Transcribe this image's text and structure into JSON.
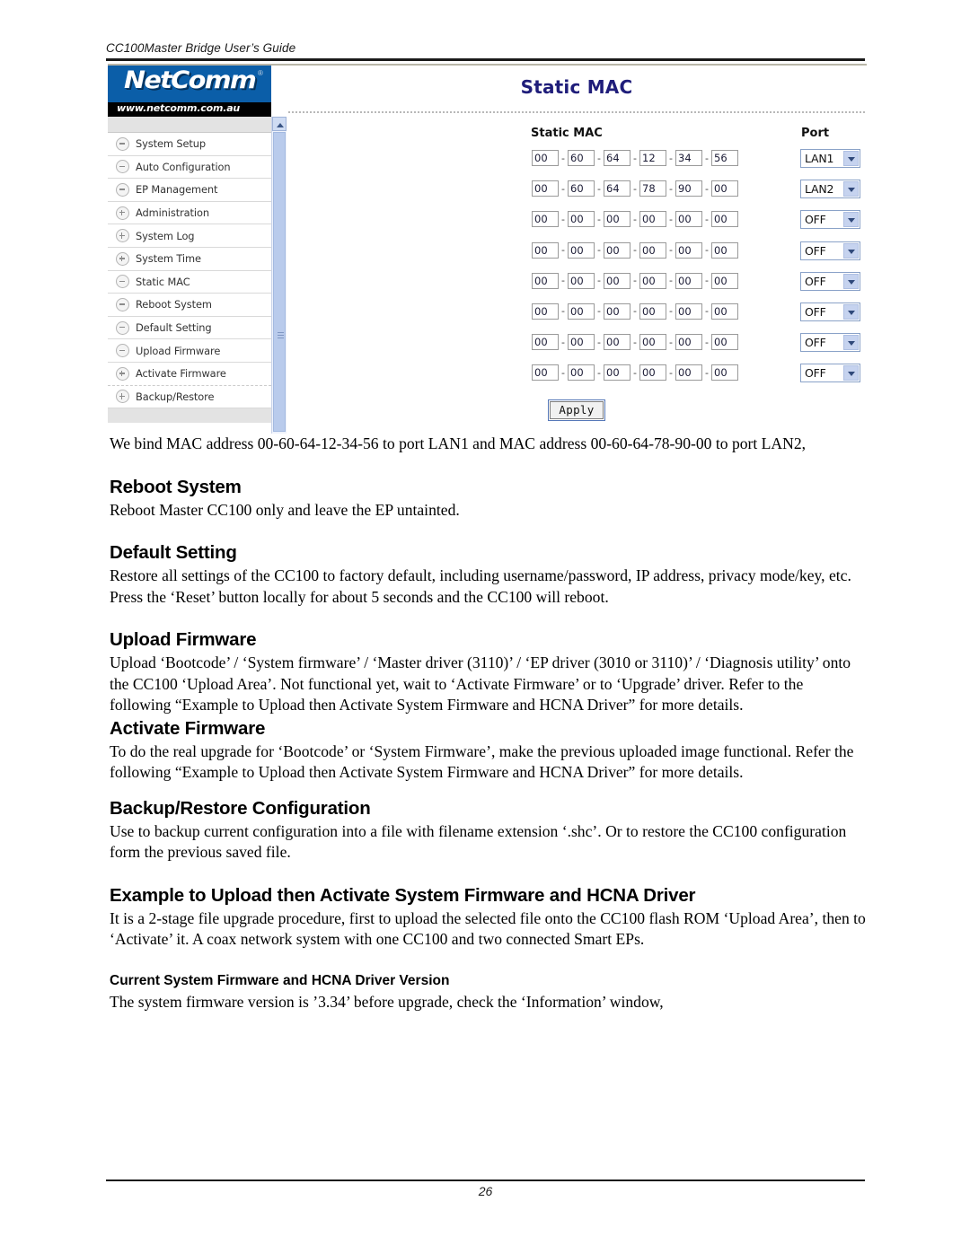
{
  "document": {
    "running_header": "CC100Master Bridge User’s Guide",
    "page_number": "26"
  },
  "screenshot": {
    "logo": {
      "wordmark": "NetComm",
      "registered": "®",
      "url": "www.netcomm.com.au"
    },
    "nav": {
      "items": [
        {
          "label": "System Setup",
          "icon": "minus-circle-icon"
        },
        {
          "label": "Auto Configuration",
          "icon": "minus-circle-icon"
        },
        {
          "label": "EP Management",
          "icon": "minus-circle-icon"
        },
        {
          "label": "Administration",
          "icon": "plus-circle-icon"
        },
        {
          "label": "System Log",
          "icon": "plus-circle-icon"
        },
        {
          "label": "System Time",
          "icon": "plus-circle-icon"
        },
        {
          "label": "Static MAC",
          "icon": "minus-circle-icon"
        },
        {
          "label": "Reboot System",
          "icon": "minus-circle-icon"
        },
        {
          "label": "Default Setting",
          "icon": "minus-circle-icon"
        },
        {
          "label": "Upload Firmware",
          "icon": "minus-circle-icon"
        },
        {
          "label": "Activate Firmware",
          "icon": "plus-circle-icon"
        },
        {
          "label": "Backup/Restore",
          "icon": "plus-circle-icon"
        }
      ]
    },
    "pane": {
      "title": "Static MAC",
      "title_color": "#1f1d7a",
      "columns": {
        "mac": "Static MAC",
        "port": "Port"
      },
      "rows": [
        {
          "octets": [
            "00",
            "60",
            "64",
            "12",
            "34",
            "56"
          ],
          "port": "LAN1"
        },
        {
          "octets": [
            "00",
            "60",
            "64",
            "78",
            "90",
            "00"
          ],
          "port": "LAN2"
        },
        {
          "octets": [
            "00",
            "00",
            "00",
            "00",
            "00",
            "00"
          ],
          "port": "OFF"
        },
        {
          "octets": [
            "00",
            "00",
            "00",
            "00",
            "00",
            "00"
          ],
          "port": "OFF"
        },
        {
          "octets": [
            "00",
            "00",
            "00",
            "00",
            "00",
            "00"
          ],
          "port": "OFF"
        },
        {
          "octets": [
            "00",
            "00",
            "00",
            "00",
            "00",
            "00"
          ],
          "port": "OFF"
        },
        {
          "octets": [
            "00",
            "00",
            "00",
            "00",
            "00",
            "00"
          ],
          "port": "OFF"
        },
        {
          "octets": [
            "00",
            "00",
            "00",
            "00",
            "00",
            "00"
          ],
          "port": "OFF"
        }
      ],
      "separator": "-",
      "apply_label": "Apply"
    }
  },
  "content": {
    "caption": "We bind MAC address 00-60-64-12-34-56 to port LAN1 and MAC address 00-60-64-78-90-00 to port LAN2,",
    "sections": [
      {
        "heading": "Reboot System",
        "body": "Reboot Master CC100 only and leave the EP untainted."
      },
      {
        "heading": "Default Setting",
        "body": "Restore all settings of the CC100 to factory default, including username/password, IP address, privacy mode/key, etc. Press the ‘Reset’ button locally for about 5 seconds and the CC100 will reboot."
      },
      {
        "heading": "Upload Firmware",
        "body": "Upload ‘Bootcode’ / ‘System firmware’ / ‘Master driver (3110)’ / ‘EP driver (3010 or 3110)’ / ‘Diagnosis utility’ onto the CC100 ‘Upload Area’. Not functional yet, wait to ‘Activate Firmware’ or to ‘Upgrade’ driver. Refer to the following “Example to Upload then Activate System Firmware and HCNA Driver” for more details."
      },
      {
        "heading": "Activate Firmware",
        "body": "To do the real upgrade for ‘Bootcode’ or ‘System Firmware’, make the previous uploaded image functional. Refer the following “Example to Upload then Activate System Firmware and HCNA Driver” for more details."
      },
      {
        "heading": "Backup/Restore Configuration",
        "body": "Use to backup current configuration into a file with filename extension ‘.shc’. Or to restore the CC100 configuration form the previous saved file."
      },
      {
        "heading": "Example to Upload then Activate System Firmware and HCNA Driver",
        "body": "It is a 2-stage file upgrade procedure, first to upload the selected file onto the CC100 flash ROM ‘Upload Area’, then to ‘Activate’ it. A coax network system with one CC100 and two connected Smart EPs."
      }
    ],
    "subsection": {
      "heading": "Current System Firmware and HCNA Driver Version",
      "body": "The system firmware version is ’3.34’ before upgrade, check the ‘Information’ window,"
    }
  }
}
